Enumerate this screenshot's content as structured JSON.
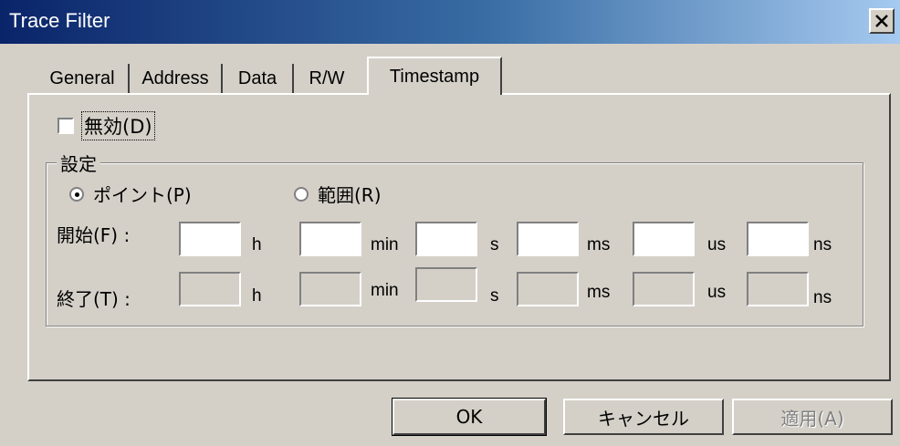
{
  "window": {
    "title": "Trace Filter"
  },
  "tabs": [
    {
      "label": "General",
      "active": false
    },
    {
      "label": "Address",
      "active": false
    },
    {
      "label": "Data",
      "active": false
    },
    {
      "label": "R/W",
      "active": false
    },
    {
      "label": "Timestamp",
      "active": true
    }
  ],
  "disable_checkbox": {
    "label": "無効(D)",
    "checked": false
  },
  "settings_group": {
    "label": "設定",
    "radio_point": {
      "label": "ポイント(P)",
      "checked": true
    },
    "radio_range": {
      "label": "範囲(R)",
      "checked": false
    }
  },
  "start_row": {
    "label": "開始(F) :",
    "units": [
      "h",
      "min",
      "s",
      "ms",
      "us",
      "ns"
    ],
    "values": [
      "",
      "",
      "",
      "",
      "",
      ""
    ]
  },
  "end_row": {
    "label": "終了(T) :",
    "units": [
      "h",
      "min",
      "s",
      "ms",
      "us",
      "ns"
    ],
    "values": [
      "",
      "",
      "",
      "",
      "",
      ""
    ],
    "disabled": true
  },
  "buttons": {
    "ok": "OK",
    "cancel": "キャンセル",
    "apply": "適用(A)"
  },
  "icons": {
    "close": "close-icon"
  },
  "colors": {
    "face": "#d4d0c8",
    "title_start": "#0a246a",
    "title_end": "#a6caf0"
  }
}
